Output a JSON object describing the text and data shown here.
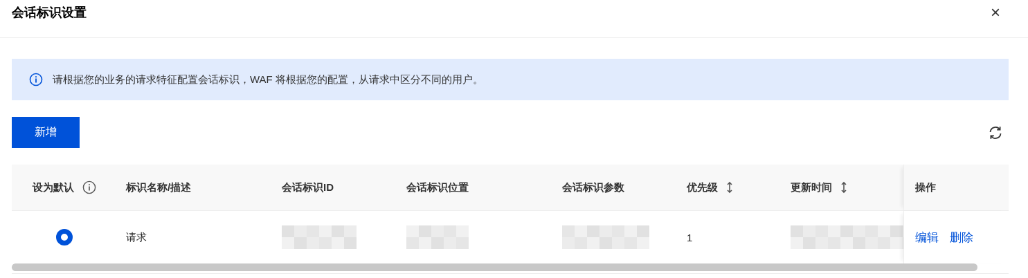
{
  "dialog": {
    "title": "会话标识设置",
    "close": "×"
  },
  "notice": {
    "text": "请根据您的业务的请求特征配置会话标识，WAF 将根据您的配置，从请求中区分不同的用户。"
  },
  "toolbar": {
    "add_button": "新增"
  },
  "table": {
    "columns": [
      {
        "label": "设为默认",
        "kind": "info"
      },
      {
        "label": "标识名称/描述",
        "kind": "plain"
      },
      {
        "label": "会话标识ID",
        "kind": "plain"
      },
      {
        "label": "会话标识位置",
        "kind": "plain"
      },
      {
        "label": "会话标识参数",
        "kind": "plain"
      },
      {
        "label": "优先级",
        "kind": "sortable"
      },
      {
        "label": "更新时间",
        "kind": "sortable"
      },
      {
        "label": "操作",
        "kind": "plain"
      }
    ],
    "rows": [
      {
        "cells": [
          {
            "kind": "radio",
            "selected": true
          },
          {
            "kind": "text",
            "text": "请求"
          },
          {
            "kind": "redacted"
          },
          {
            "kind": "redacted"
          },
          {
            "kind": "redacted"
          },
          {
            "kind": "text",
            "text": "1"
          },
          {
            "kind": "redacted"
          },
          {
            "kind": "actions",
            "links": [
              "编辑",
              "删除"
            ]
          }
        ]
      }
    ]
  }
}
